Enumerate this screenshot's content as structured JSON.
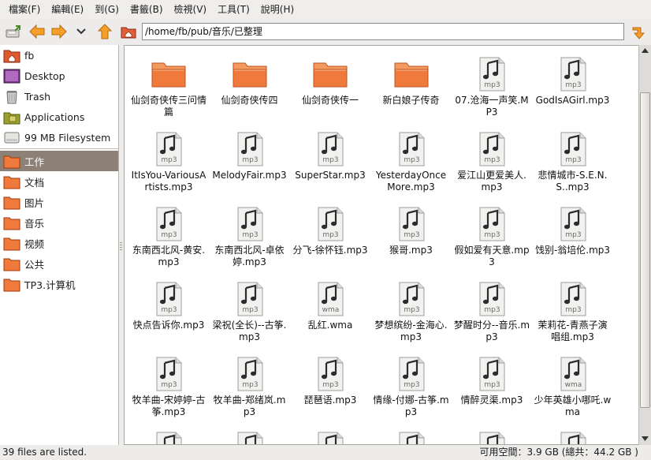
{
  "menu": {
    "file": "檔案(F)",
    "edit": "編輯(E)",
    "go": "到(G)",
    "bookmarks": "書籤(B)",
    "view": "檢視(V)",
    "tools": "工具(T)",
    "help": "說明(H)"
  },
  "location": {
    "path": "/home/fb/pub/音乐/已整理"
  },
  "sidebar": {
    "places": [
      {
        "label": "fb",
        "icon": "home-folder-icon"
      },
      {
        "label": "Desktop",
        "icon": "desktop-icon"
      },
      {
        "label": "Trash",
        "icon": "trash-icon"
      },
      {
        "label": "Applications",
        "icon": "applications-icon"
      },
      {
        "label": "99 MB Filesystem",
        "icon": "drive-icon"
      }
    ],
    "bookmarks": [
      {
        "label": "工作",
        "icon": "folder-icon",
        "selected": true
      },
      {
        "label": "文档",
        "icon": "folder-icon"
      },
      {
        "label": "图片",
        "icon": "folder-icon"
      },
      {
        "label": "音乐",
        "icon": "folder-icon"
      },
      {
        "label": "视频",
        "icon": "folder-icon"
      },
      {
        "label": "公共",
        "icon": "folder-icon"
      },
      {
        "label": "TP3.计算机",
        "icon": "folder-icon"
      }
    ]
  },
  "files": [
    {
      "name": "仙剑奇侠传三问情篇",
      "type": "folder"
    },
    {
      "name": "仙剑奇侠传四",
      "type": "folder"
    },
    {
      "name": "仙剑奇侠传一",
      "type": "folder"
    },
    {
      "name": "新白娘子传奇",
      "type": "folder"
    },
    {
      "name": "07.沧海一声笑.MP3",
      "type": "mp3"
    },
    {
      "name": "GodIsAGirl.mp3",
      "type": "mp3"
    },
    {
      "name": "ItIsYou-VariousArtists.mp3",
      "type": "mp3"
    },
    {
      "name": "MelodyFair.mp3",
      "type": "mp3"
    },
    {
      "name": "SuperStar.mp3",
      "type": "mp3"
    },
    {
      "name": "YesterdayOnceMore.mp3",
      "type": "mp3"
    },
    {
      "name": "爱江山更爱美人.mp3",
      "type": "mp3"
    },
    {
      "name": "悲情城市-S.E.N.S..mp3",
      "type": "mp3"
    },
    {
      "name": "东南西北风-黄安.mp3",
      "type": "mp3"
    },
    {
      "name": "东南西北风-卓依婷.mp3",
      "type": "mp3"
    },
    {
      "name": "分飞-徐怀钰.mp3",
      "type": "mp3"
    },
    {
      "name": "猴哥.mp3",
      "type": "mp3"
    },
    {
      "name": "假如爱有天意.mp3",
      "type": "mp3"
    },
    {
      "name": "饯别-翁培伦.mp3",
      "type": "mp3"
    },
    {
      "name": "快点告诉你.mp3",
      "type": "mp3"
    },
    {
      "name": "梁祝(全长)--古筝.mp3",
      "type": "mp3"
    },
    {
      "name": "乱红.wma",
      "type": "wma"
    },
    {
      "name": "梦想缤纷-金海心.mp3",
      "type": "mp3"
    },
    {
      "name": "梦醒时分--音乐.mp3",
      "type": "mp3"
    },
    {
      "name": "茉莉花-青燕子演唱组.mp3",
      "type": "mp3"
    },
    {
      "name": "牧羊曲-宋婷婷-古筝.mp3",
      "type": "mp3"
    },
    {
      "name": "牧羊曲-郑绪岚.mp3",
      "type": "mp3"
    },
    {
      "name": "琵琶语.mp3",
      "type": "mp3"
    },
    {
      "name": "情缘-付娜-古筝.mp3",
      "type": "mp3"
    },
    {
      "name": "情醉灵渠.mp3",
      "type": "mp3"
    },
    {
      "name": "少年英雄小哪吒.wma",
      "type": "wma"
    },
    {
      "name": "",
      "type": "mp3"
    },
    {
      "name": "",
      "type": "mp3"
    },
    {
      "name": "",
      "type": "mp3"
    },
    {
      "name": "",
      "type": "mp3"
    },
    {
      "name": "",
      "type": "mp3"
    },
    {
      "name": "",
      "type": "mp3"
    }
  ],
  "status": {
    "left": "39 files are listed.",
    "right": "可用空間：3.9 GB (總共：44.2 GB )"
  },
  "colors": {
    "folder_orange": "#f07a3c",
    "selection": "#8c8077",
    "accent_arrow": "#f0a030"
  }
}
